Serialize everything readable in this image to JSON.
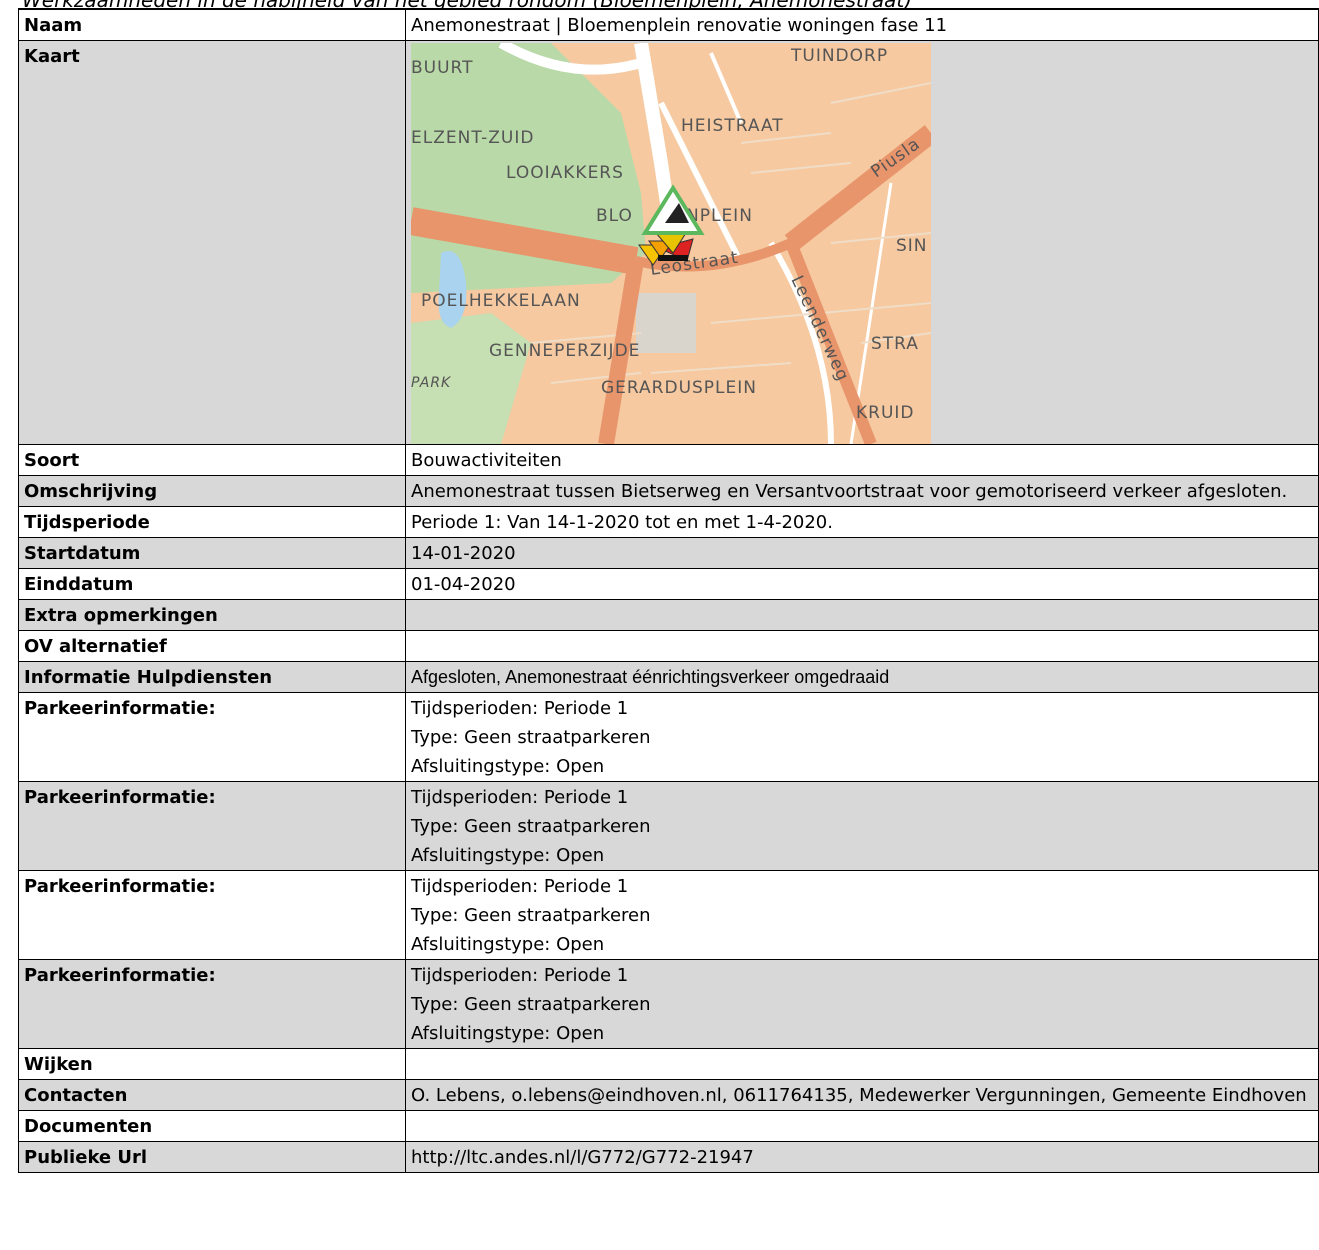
{
  "cut_header": "Werkzaamheden in de nabijheid van het gebied rondom (Bloemenplein, Anemonestraat)",
  "rows": {
    "naam": {
      "label": "Naam",
      "value": "Anemonestraat | Bloemenplein renovatie woningen fase 11"
    },
    "kaart": {
      "label": "Kaart",
      "map_labels": [
        "BUURT",
        "TUINDORP",
        "ELZENT-ZUID",
        "HEISTRAAT",
        "LOOIAKKERS",
        "Piusla",
        "BLO",
        "NPLEIN",
        "SIN",
        "Leostraat",
        "POELHEKKELAAN",
        "Leenderweg",
        "STRA",
        "GENNEPERZIJDE",
        "PARK",
        "GERARDUSPLEIN",
        "KRUID"
      ]
    },
    "soort": {
      "label": "Soort",
      "value": "Bouwactiviteiten"
    },
    "omschrijving": {
      "label": "Omschrijving",
      "value": "Anemonestraat tussen Bietserweg en Versantvoortstraat voor gemotoriseerd verkeer afgesloten."
    },
    "tijdsperiode": {
      "label": "Tijdsperiode",
      "value": "Periode 1: Van 14-1-2020 tot en met 1-4-2020."
    },
    "startdatum": {
      "label": "Startdatum",
      "value": "14-01-2020"
    },
    "einddatum": {
      "label": "Einddatum",
      "value": "01-04-2020"
    },
    "extra": {
      "label": "Extra opmerkingen",
      "value": ""
    },
    "ov": {
      "label": "OV alternatief",
      "value": ""
    },
    "hulpdiensten": {
      "label": "Informatie Hulpdiensten",
      "value": "Afgesloten, Anemonestraat éénrichtingsverkeer omgedraaid"
    },
    "parkeer": [
      {
        "label": "Parkeerinformatie:",
        "l1": "Tijdsperioden: Periode 1",
        "l2": "Type: Geen straatparkeren",
        "l3": "Afsluitingstype: Open"
      },
      {
        "label": "Parkeerinformatie:",
        "l1": "Tijdsperioden: Periode 1",
        "l2": "Type: Geen straatparkeren",
        "l3": "Afsluitingstype: Open"
      },
      {
        "label": "Parkeerinformatie:",
        "l1": "Tijdsperioden: Periode 1",
        "l2": "Type: Geen straatparkeren",
        "l3": "Afsluitingstype: Open"
      },
      {
        "label": "Parkeerinformatie:",
        "l1": "Tijdsperioden: Periode 1",
        "l2": "Type: Geen straatparkeren",
        "l3": "Afsluitingstype: Open"
      }
    ],
    "wijken": {
      "label": "Wijken",
      "value": ""
    },
    "contacten": {
      "label": "Contacten",
      "value": "O. Lebens, o.lebens@eindhoven.nl, 0611764135, Medewerker Vergunningen, Gemeente Eindhoven"
    },
    "documenten": {
      "label": "Documenten",
      "value": ""
    },
    "url": {
      "label": "Publieke Url",
      "value": "http://ltc.andes.nl/l/G772/G772-21947"
    }
  },
  "colors": {
    "row_alt": "#d8d8d8",
    "map_land": "#f6c9a0",
    "map_road": "#e8956b",
    "map_green": "#b9d9a8",
    "map_water": "#a9d3ee"
  }
}
